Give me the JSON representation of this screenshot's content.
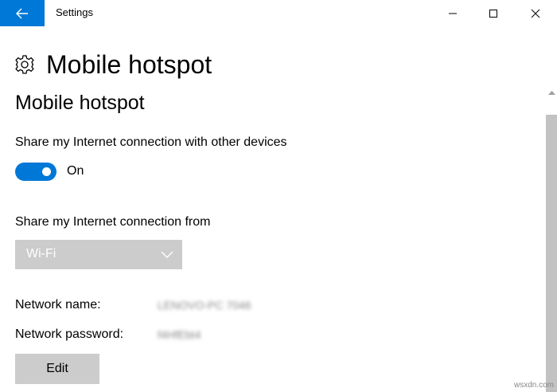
{
  "window": {
    "title": "Settings"
  },
  "header": {
    "icon": "gear-icon",
    "title": "Mobile hotspot"
  },
  "section": {
    "title": "Mobile hotspot"
  },
  "share_toggle": {
    "label": "Share my Internet connection with other devices",
    "state_text": "On",
    "is_on": true
  },
  "share_from": {
    "label": "Share my Internet connection from",
    "selected": "Wi-Fi"
  },
  "network": {
    "name_label": "Network name:",
    "name_value": "LENOVO-PC 7046",
    "password_label": "Network password:",
    "password_value": "f4HfEbt4"
  },
  "edit_button": {
    "label": "Edit"
  },
  "watermark": "wsxdn.com",
  "colors": {
    "accent": "#0078d7",
    "disabled_bg": "#cccccc",
    "scroll_thumb": "#c2c2c2"
  }
}
